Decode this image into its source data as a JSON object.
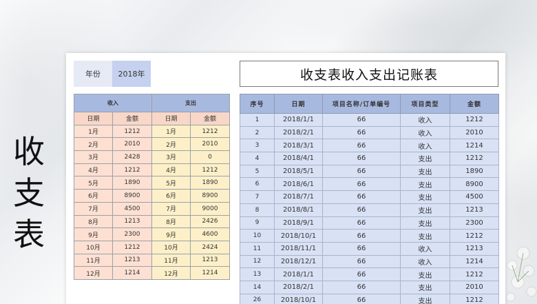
{
  "side_title": [
    "收",
    "支",
    "表"
  ],
  "year": {
    "label": "年份",
    "value": "2018年"
  },
  "title": "收支表收入支出记账表",
  "left_table": {
    "group_income": "收入",
    "group_expense": "支出",
    "headers": [
      "日期",
      "金额",
      "日期",
      "金额"
    ],
    "rows": [
      [
        "1月",
        "1212",
        "1月",
        "1212"
      ],
      [
        "2月",
        "2010",
        "2月",
        "2010"
      ],
      [
        "3月",
        "2428",
        "3月",
        "0"
      ],
      [
        "4月",
        "1212",
        "4月",
        "1212"
      ],
      [
        "5月",
        "1890",
        "5月",
        "1890"
      ],
      [
        "6月",
        "8900",
        "6月",
        "8900"
      ],
      [
        "7月",
        "4500",
        "7月",
        "9000"
      ],
      [
        "8月",
        "1213",
        "8月",
        "2426"
      ],
      [
        "9月",
        "2300",
        "9月",
        "4600"
      ],
      [
        "10月",
        "1212",
        "10月",
        "2424"
      ],
      [
        "11月",
        "1213",
        "11月",
        "1213"
      ],
      [
        "12月",
        "1214",
        "12月",
        "1214"
      ]
    ]
  },
  "right_table": {
    "headers": [
      "序号",
      "日期",
      "项目名称/订单编号",
      "项目类型",
      "金额"
    ],
    "rows": [
      [
        "1",
        "2018/1/1",
        "66",
        "收入",
        "1212"
      ],
      [
        "2",
        "2018/2/1",
        "66",
        "收入",
        "2010"
      ],
      [
        "3",
        "2018/3/1",
        "66",
        "收入",
        "1214"
      ],
      [
        "4",
        "2018/4/1",
        "66",
        "支出",
        "1212"
      ],
      [
        "5",
        "2018/5/1",
        "66",
        "支出",
        "1890"
      ],
      [
        "6",
        "2018/6/1",
        "66",
        "支出",
        "8900"
      ],
      [
        "7",
        "2018/7/1",
        "66",
        "支出",
        "4500"
      ],
      [
        "8",
        "2018/8/1",
        "66",
        "支出",
        "1213"
      ],
      [
        "9",
        "2018/9/1",
        "66",
        "支出",
        "2300"
      ],
      [
        "10",
        "2018/10/1",
        "66",
        "支出",
        "1212"
      ],
      [
        "11",
        "2018/11/1",
        "66",
        "收入",
        "1213"
      ],
      [
        "12",
        "2018/12/1",
        "66",
        "收入",
        "1214"
      ],
      [
        "13",
        "2018/1/1",
        "66",
        "支出",
        "1212"
      ],
      [
        "14",
        "2018/2/1",
        "66",
        "支出",
        "2010"
      ],
      [
        "26",
        "2018/10/1",
        "66",
        "支出",
        "1212"
      ]
    ]
  }
}
